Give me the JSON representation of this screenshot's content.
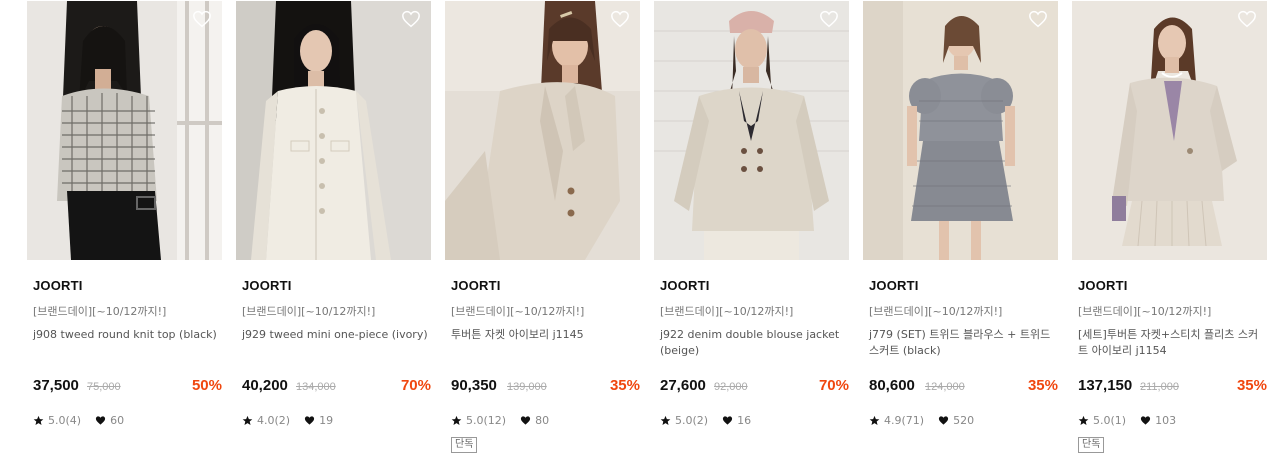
{
  "products": [
    {
      "brand": "JOORTI",
      "promo": "[브랜드데이][~10/12까지!]",
      "name": "j908 tweed round knit top (black)",
      "price": "37,500",
      "original_price": "75,000",
      "discount": "50%",
      "rating": "5.0(4)",
      "likes": "60",
      "badge": "",
      "image_icon": "model-tweed-knit-top-photo"
    },
    {
      "brand": "JOORTI",
      "promo": "[브랜드데이][~10/12까지!]",
      "name": "j929 tweed mini one-piece (ivory)",
      "price": "40,200",
      "original_price": "134,000",
      "discount": "70%",
      "rating": "4.0(2)",
      "likes": "19",
      "badge": "",
      "image_icon": "model-ivory-one-piece-photo"
    },
    {
      "brand": "JOORTI",
      "promo": "[브랜드데이][~10/12까지!]",
      "name": "투버튼 자켓 아이보리 j1145",
      "price": "90,350",
      "original_price": "139,000",
      "discount": "35%",
      "rating": "5.0(12)",
      "likes": "80",
      "badge": "단독",
      "image_icon": "model-ivory-jacket-photo"
    },
    {
      "brand": "JOORTI",
      "promo": "[브랜드데이][~10/12까지!]",
      "name": "j922 denim double blouse jacket (beige)",
      "price": "27,600",
      "original_price": "92,000",
      "discount": "70%",
      "rating": "5.0(2)",
      "likes": "16",
      "badge": "",
      "image_icon": "model-beige-denim-jacket-photo"
    },
    {
      "brand": "JOORTI",
      "promo": "[브랜드데이][~10/12까지!]",
      "name": "j779 (SET) 트위드 블라우스 + 트위드 스커트 (black)",
      "price": "80,600",
      "original_price": "124,000",
      "discount": "35%",
      "rating": "4.9(71)",
      "likes": "520",
      "badge": "",
      "image_icon": "model-tweed-set-photo"
    },
    {
      "brand": "JOORTI",
      "promo": "[브랜드데이][~10/12까지!]",
      "name": "[세트]투버튼 자켓+스티치 플리츠 스커트 아이보리 j1154",
      "price": "137,150",
      "original_price": "211,000",
      "discount": "35%",
      "rating": "5.0(1)",
      "likes": "103",
      "badge": "단독",
      "image_icon": "model-ivory-set-photo"
    }
  ],
  "colors": {
    "discount": "#f0470f",
    "price": "#111111",
    "muted": "#888888"
  },
  "icons": {
    "wishlist": "heart-outline-icon",
    "rating": "star-icon",
    "likes": "heart-filled-icon"
  }
}
